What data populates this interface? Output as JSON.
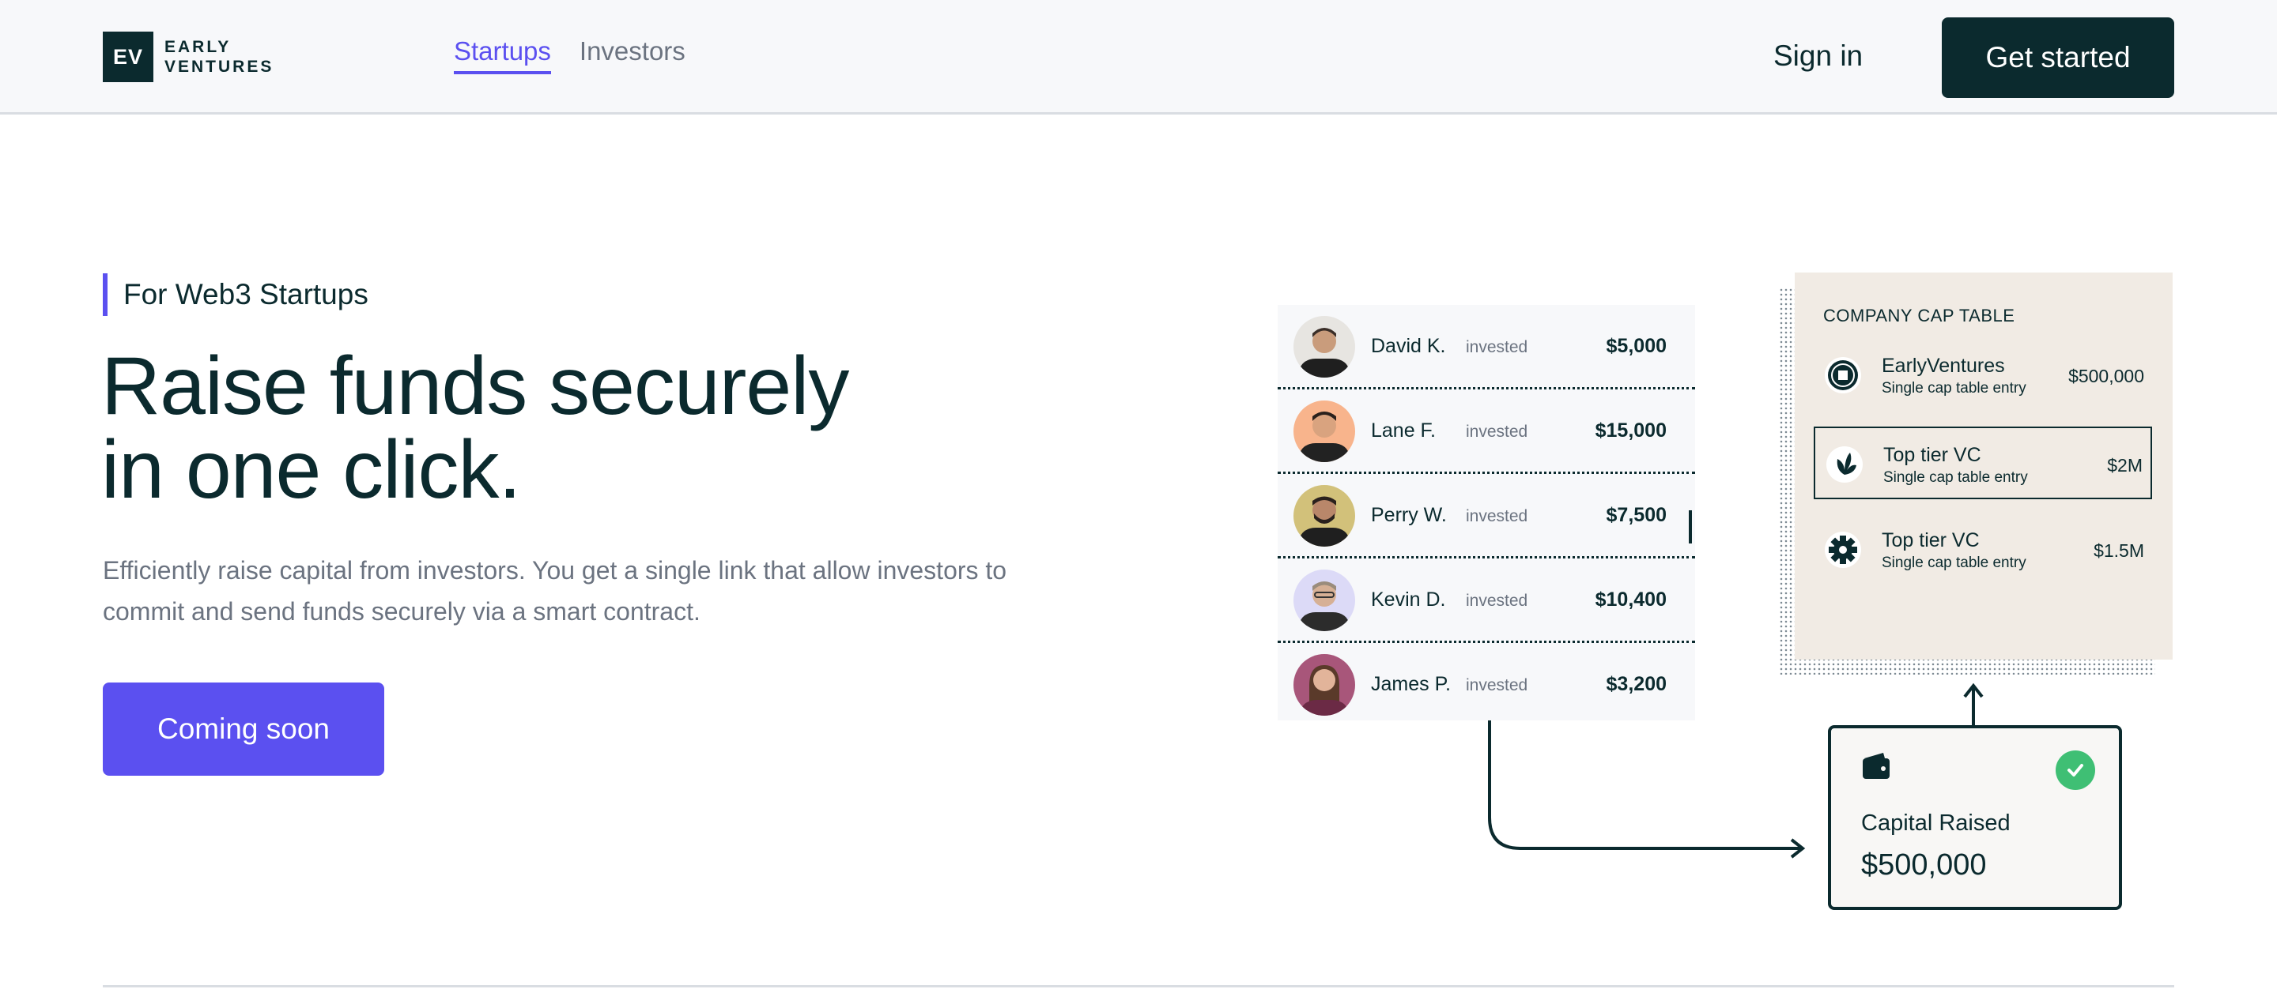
{
  "header": {
    "logo_mark": "EV",
    "logo_line1": "EARLY",
    "logo_line2": "VENTURES",
    "nav": [
      {
        "label": "Startups",
        "active": true
      },
      {
        "label": "Investors",
        "active": false
      }
    ],
    "signin_label": "Sign in",
    "cta_label": "Get started"
  },
  "hero": {
    "eyebrow": "For Web3 Startups",
    "headline_line1": "Raise funds securely",
    "headline_line2": "in one click.",
    "description": "Efficiently raise capital from investors. You get a single link that allow investors to commit and send funds securely via a smart contract.",
    "button_label": "Coming soon"
  },
  "investors": [
    {
      "name": "David K.",
      "verb": "invested",
      "amount": "$5,000",
      "avatar_bg": "#e7e5e1"
    },
    {
      "name": "Lane F.",
      "verb": "invested",
      "amount": "$15,000",
      "avatar_bg": "#f8b48c"
    },
    {
      "name": "Perry W.",
      "verb": "invested",
      "amount": "$7,500",
      "avatar_bg": "#d2c17a"
    },
    {
      "name": "Kevin D.",
      "verb": "invested",
      "amount": "$10,400",
      "avatar_bg": "#dcdaf7"
    },
    {
      "name": "James P.",
      "verb": "invested",
      "amount": "$3,200",
      "avatar_bg": "#a8567a"
    }
  ],
  "cap_table": {
    "title": "COMPANY CAP TABLE",
    "rows": [
      {
        "name": "EarlyVentures",
        "sub": "Single cap table entry",
        "value": "$500,000",
        "icon": "ev-coin-icon"
      },
      {
        "name": "Top tier VC",
        "sub": "Single cap table entry",
        "value": "$2M",
        "icon": "leaf-icon"
      },
      {
        "name": "Top tier VC",
        "sub": "Single cap table entry",
        "value": "$1.5M",
        "icon": "gear-icon"
      }
    ]
  },
  "capital": {
    "label": "Capital Raised",
    "amount": "$500,000"
  },
  "colors": {
    "brand_dark": "#0b2a2e",
    "accent": "#5b50f0",
    "success": "#3fbf74",
    "cap_bg": "#f1ebe4"
  }
}
